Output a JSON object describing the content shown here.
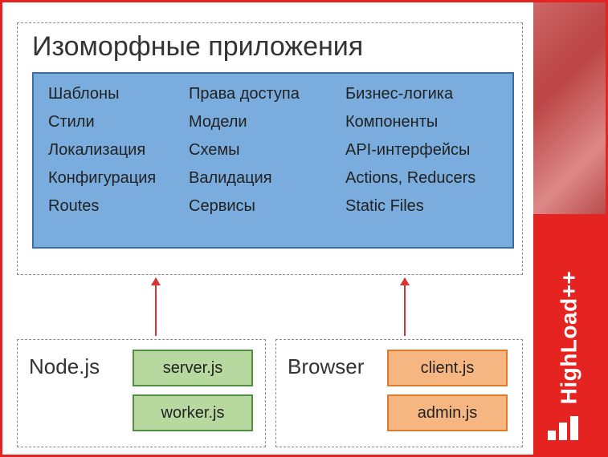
{
  "brand": "HighLoad++",
  "iso": {
    "title": "Изоморфные приложения",
    "shared": {
      "col1": [
        "Шаблоны",
        "Стили",
        "Локализация",
        "Конфигурация",
        "Routes"
      ],
      "col2": [
        "Права доступа",
        "Модели",
        "Схемы",
        "Валидация",
        "Сервисы"
      ],
      "col3": [
        "Бизнес-логика",
        "Компоненты",
        "API-интерфейсы",
        "Actions, Reducers",
        "Static Files"
      ]
    }
  },
  "envs": {
    "node": {
      "title": "Node.js",
      "files": [
        "server.js",
        "worker.js"
      ],
      "color": "green"
    },
    "browser": {
      "title": "Browser",
      "files": [
        "client.js",
        "admin.js"
      ],
      "color": "orange"
    }
  }
}
